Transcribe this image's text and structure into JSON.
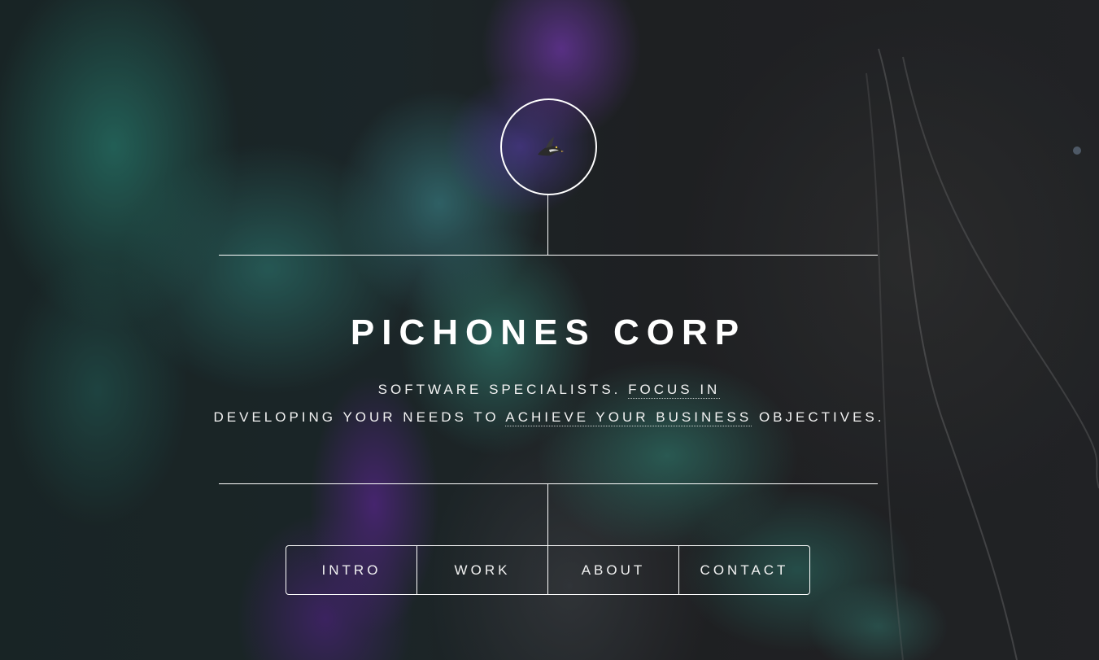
{
  "header": {
    "logo_icon": "bird-icon",
    "title": "PICHONES CORP"
  },
  "tagline": {
    "line1_text": "SOFTWARE SPECIALISTS. ",
    "line1_link": "FOCUS IN",
    "line2_text_before": "DEVELOPING YOUR NEEDS TO ",
    "line2_link": "ACHIEVE YOUR BUSINESS",
    "line2_text_after": " OBJECTIVES."
  },
  "nav": {
    "items": [
      {
        "label": "INTRO"
      },
      {
        "label": "WORK"
      },
      {
        "label": "ABOUT"
      },
      {
        "label": "CONTACT"
      }
    ]
  },
  "colors": {
    "foreground": "#ffffff",
    "smoke_teal": "#2c9684",
    "smoke_purple": "#803ec4",
    "background_dark": "#161a1d"
  }
}
